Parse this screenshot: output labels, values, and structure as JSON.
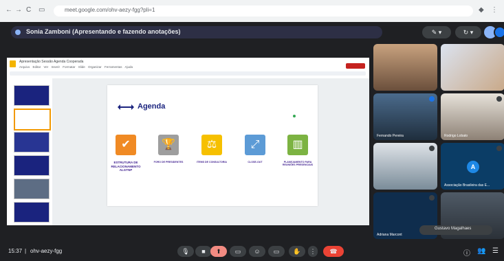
{
  "browser": {
    "nav_back": "←",
    "nav_forward": "→",
    "nav_reload": "C",
    "nav_tabs": "▭",
    "url": "meet.google.com/ohv-aezy-fgg?pli=1",
    "ext_icon": "◆",
    "profile_icon": "⋮"
  },
  "meet_top": {
    "presenting_label": "Sonia Zamboni (Apresentando e fazendo anotações)",
    "toolbar_btn1": "✎ ▾",
    "toolbar_btn2": "↻ ▾"
  },
  "slides_app": {
    "doc_title": "Apresentação Sessão Agenda Cooperada",
    "menu": "Arquivo Editar Ver Inserir Formatar Slide Organizar Ferramentas Ajuda"
  },
  "slide": {
    "title": "Agenda",
    "items": [
      {
        "icon": "✔",
        "label": "ESTRUTURA DE RELACIONAMENTO ALGTNP",
        "color": "#f08a24"
      },
      {
        "icon": "🏆",
        "label": "FORO DE PRESIDENTES",
        "color": "#9e9e9e"
      },
      {
        "icon": "⚖",
        "label": "ITEMS DE CONSULTORIA",
        "color": "#f6c000"
      },
      {
        "icon": "⤢",
        "label": "CLOSE-OUT",
        "color": "#5c9bd6"
      },
      {
        "icon": "▥",
        "label": "PLANEJAMENTO PARA REUNIÕES PRESENCIAIS",
        "color": "#7cb342"
      }
    ]
  },
  "participants": [
    {
      "name": ""
    },
    {
      "name": ""
    },
    {
      "name": "Fernando Pereira"
    },
    {
      "name": "Rodrigo Lobato"
    },
    {
      "name": ""
    },
    {
      "name": "Associação Brasileira das E..."
    },
    {
      "name": "Adriana Marcont"
    },
    {
      "name": ""
    }
  ],
  "pinned_name": "Gustavo Magalhaes",
  "avatar_letter": "A",
  "bottom": {
    "time": "15:37",
    "separator": "|",
    "meeting_code": "ohv-aezy-fgg",
    "mic_icon": "🎙",
    "cam_icon": "■",
    "present_icon": "⬆",
    "cc_icon": "▭",
    "emoji_icon": "☺",
    "raise_icon": "✋",
    "more_icon": "⋮",
    "hangup_icon": "☎",
    "info_icon": "ⓘ",
    "people_icon": "👥",
    "chat_icon": "☰"
  }
}
